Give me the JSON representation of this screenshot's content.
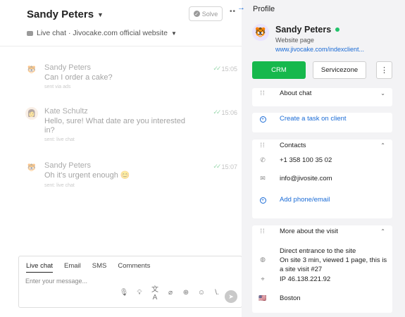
{
  "header": {
    "contact_name": "Sandy Peters",
    "solve_label": "Solve",
    "channel_text": "Live chat · Jivocake.com official website"
  },
  "messages": [
    {
      "author": "Sandy Peters",
      "text": "Can I order a cake?",
      "via": "sent via ads",
      "time": "15:05",
      "avatar": "🐯"
    },
    {
      "author": "Kate Schultz",
      "text": "Hello, sure! What date are you interested in?",
      "via": "sent: live chat",
      "time": "15:06",
      "avatar": "👩"
    },
    {
      "author": "Sandy Peters",
      "text": "Oh it's urgent enough 😊",
      "via": "sent: live chat",
      "time": "15:07",
      "avatar": "🐯"
    }
  ],
  "composer": {
    "tabs": [
      "Live chat",
      "Email",
      "SMS",
      "Comments"
    ],
    "active_tab": "Live chat",
    "placeholder": "Enter your message...",
    "tools": [
      "mic-icon",
      "lightbulb-icon",
      "translate-icon",
      "attachment-icon",
      "target-icon",
      "emoji-icon",
      "slash-icon"
    ]
  },
  "profile": {
    "title": "Profile",
    "name": "Sandy Peters",
    "online": true,
    "source": "Website page",
    "url": "www.jivocake.com/indexclient...",
    "crm_label": "CRM",
    "servicezone_label": "Servicezone",
    "about_chat": "About chat",
    "create_task": "Create a task on client",
    "contacts_title": "Contacts",
    "phone": "+1 358 100 35 02",
    "email": "info@jivosite.com",
    "add_contact": "Add phone/email",
    "visit_title": "More about the visit",
    "visit_source": "Direct entrance to the site",
    "visit_stats": "On site 3 min, viewed 1 page, this is a site visit #27",
    "ip": "IP 46.138.221.92",
    "city": "Boston"
  },
  "colors": {
    "crm_green": "#16b84c",
    "link_blue": "#1a6bd6",
    "online_green": "#22c36b",
    "panel_bg": "#f3f3f5"
  }
}
